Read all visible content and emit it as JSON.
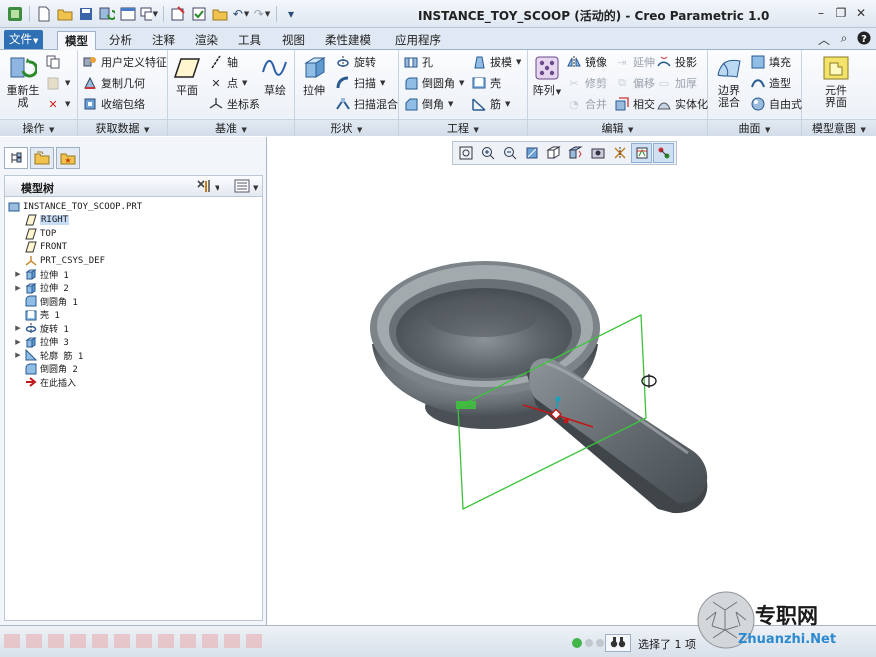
{
  "window": {
    "title": "INSTANCE_TOY_SCOOP (活动的) - Creo Parametric 1.0"
  },
  "quick_access": {
    "icons": [
      "app-icon",
      "new-icon",
      "open-icon",
      "save-icon",
      "regenerate-icon",
      "window-icon",
      "windows-icon",
      "close-window-icon",
      "undo-icon",
      "redo-icon",
      "customize-icon"
    ]
  },
  "tabs": {
    "file": "文件",
    "items": [
      "模型",
      "分析",
      "注释",
      "渲染",
      "工具",
      "视图",
      "柔性建模",
      "应用程序"
    ],
    "active": "模型"
  },
  "ribbon": {
    "groups": {
      "operations": "操作",
      "get_data": "获取数据",
      "datum": "基准",
      "shapes": "形状",
      "engineering": "工程",
      "editing": "编辑",
      "surfaces": "曲面",
      "model_intent": "模型意图"
    },
    "regenerate": "重新生成",
    "user_feature": "用户定义特征",
    "copy_geometry": "复制几何",
    "shrinkwrap": "收缩包络",
    "plane": "平面",
    "axis": "轴",
    "point": "点",
    "csys": "坐标系",
    "sketch": "草绘",
    "extrude": "拉伸",
    "revolve": "旋转",
    "sweep": "扫描",
    "swept_blend": "扫描混合",
    "hole": "孔",
    "round": "倒圆角",
    "chamfer": "倒角",
    "draft": "拔模",
    "shell": "壳",
    "rib": "筋",
    "pattern": "阵列",
    "mirror": "镜像",
    "trim": "修剪",
    "merge": "合并",
    "extend": "延伸",
    "offset": "偏移",
    "intersect": "相交",
    "project": "投影",
    "thicken": "加厚",
    "solidify": "实体化",
    "boundary_blend": "边界混合",
    "fill": "填充",
    "style": "造型",
    "freestyle": "自由式",
    "component_interface": "元件界面"
  },
  "model_tree": {
    "title": "模型树",
    "nodes": [
      {
        "label": "INSTANCE_TOY_SCOOP.PRT",
        "icon": "part-icon",
        "expandable": false,
        "indent": 0
      },
      {
        "label": "RIGHT",
        "icon": "datum-plane-icon",
        "expandable": false,
        "indent": 1,
        "selected": true
      },
      {
        "label": "TOP",
        "icon": "datum-plane-icon",
        "expandable": false,
        "indent": 1
      },
      {
        "label": "FRONT",
        "icon": "datum-plane-icon",
        "expandable": false,
        "indent": 1
      },
      {
        "label": "PRT_CSYS_DEF",
        "icon": "csys-icon",
        "expandable": false,
        "indent": 1
      },
      {
        "label": "拉伸 1",
        "icon": "extrude-icon",
        "expandable": true,
        "indent": 1
      },
      {
        "label": "拉伸 2",
        "icon": "extrude-icon",
        "expandable": true,
        "indent": 1
      },
      {
        "label": "倒圆角 1",
        "icon": "round-icon",
        "expandable": false,
        "indent": 1
      },
      {
        "label": "壳 1",
        "icon": "shell-icon",
        "expandable": false,
        "indent": 1
      },
      {
        "label": "旋转 1",
        "icon": "revolve-icon",
        "expandable": true,
        "indent": 1
      },
      {
        "label": "拉伸 3",
        "icon": "extrude-icon",
        "expandable": true,
        "indent": 1
      },
      {
        "label": "轮廓 筋 1",
        "icon": "rib-icon",
        "expandable": true,
        "indent": 1
      },
      {
        "label": "倒圆角 2",
        "icon": "round-icon",
        "expandable": false,
        "indent": 1
      },
      {
        "label": "在此插入",
        "icon": "insert-arrow-icon",
        "expandable": false,
        "indent": 1
      }
    ]
  },
  "graphics_toolbar": {
    "icons": [
      "refit-icon",
      "zoom-in-icon",
      "zoom-out-icon",
      "repaint-icon",
      "display-style-icon",
      "saved-views-icon",
      "view-manager-icon",
      "perspective-icon",
      "datum-display-icon",
      "spin-center-icon",
      "annotation-display-icon"
    ]
  },
  "status": {
    "message": "选择了 1 项"
  },
  "watermark": {
    "brand": "专职网",
    "url": "Zhuanzhi.Net"
  },
  "colors": {
    "file_tab": "#2f6fb3",
    "model_body": "#5d6469",
    "datum_plane": "#3cc43c",
    "selection_highlight": "#c7dcf5"
  }
}
